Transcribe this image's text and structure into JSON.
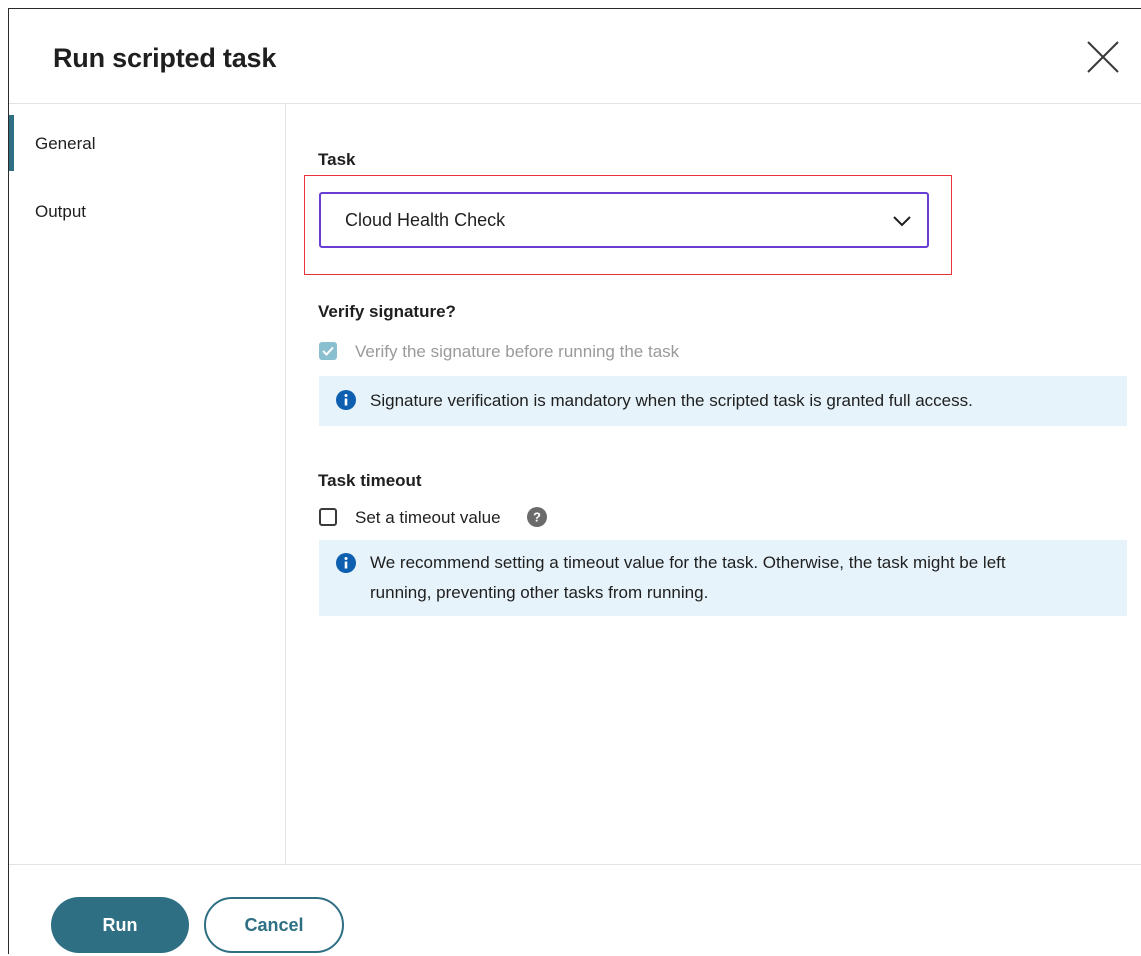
{
  "dialog": {
    "title": "Run scripted task",
    "close_icon": "close-icon"
  },
  "sidebar": {
    "items": [
      {
        "label": "General",
        "active": true
      },
      {
        "label": "Output",
        "active": false
      }
    ]
  },
  "task": {
    "label": "Task",
    "selected_value": "Cloud Health Check",
    "chevron_icon": "chevron-down-icon"
  },
  "verify": {
    "label": "Verify signature?",
    "checkbox_label": "Verify the signature before running the task",
    "checked": true,
    "disabled": true,
    "info_text": "Signature verification is mandatory when the scripted task is granted full access."
  },
  "timeout": {
    "label": "Task timeout",
    "checkbox_label": "Set a timeout value",
    "checked": false,
    "help_icon": "help-icon",
    "info_line1": "We recommend setting a timeout value for the task. Otherwise, the task might be left",
    "info_line2": "running, preventing other tasks from running."
  },
  "footer": {
    "run_label": "Run",
    "cancel_label": "Cancel"
  },
  "colors": {
    "accent": "#2f6f83",
    "select_border": "#6a3dd4",
    "highlight": "#e8323d",
    "info_bg": "#e6f3fb",
    "info_icon": "#0f5fb0"
  }
}
